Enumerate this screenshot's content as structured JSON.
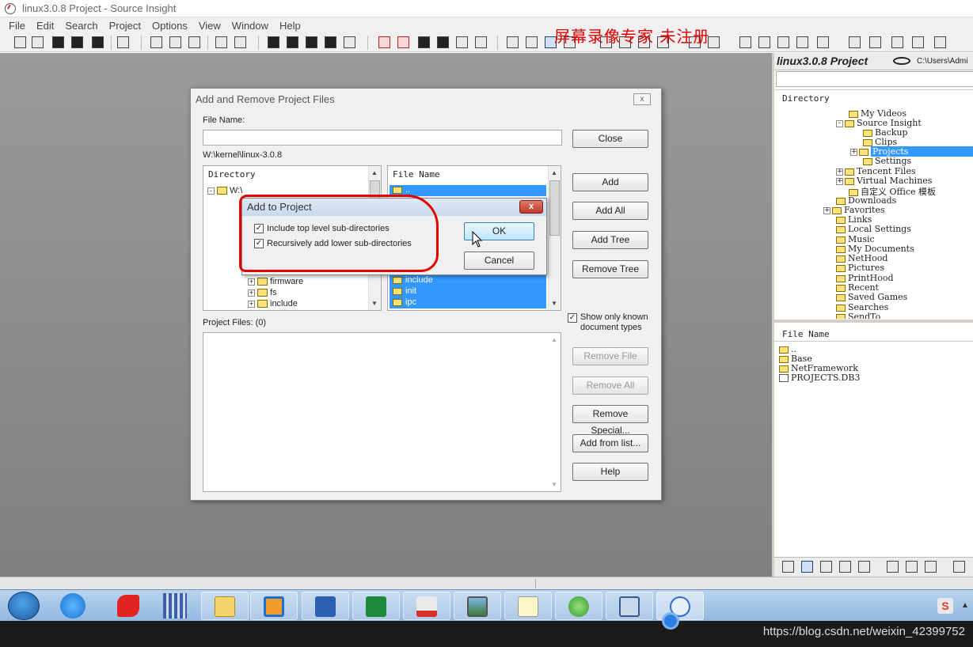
{
  "window": {
    "title": "linux3.0.8 Project - Source Insight"
  },
  "menu": [
    "File",
    "Edit",
    "Search",
    "Project",
    "Options",
    "View",
    "Window",
    "Help"
  ],
  "watermark": "屏幕录像专家 未注册",
  "dialog": {
    "title": "Add and Remove Project Files",
    "close_icon": "x",
    "file_name_label": "File Name:",
    "file_name_value": "",
    "path": "W:\\kernel\\linux-3.0.8",
    "directory_header": "Directory",
    "file_name_header": "File Name",
    "tree": [
      {
        "label": "W:\\",
        "expander": "-"
      },
      {
        "label": "firmware",
        "expander": "+"
      },
      {
        "label": "fs",
        "expander": "+"
      },
      {
        "label": "include",
        "expander": "+"
      }
    ],
    "files": [
      "..",
      "include",
      "init",
      "ipc"
    ],
    "project_files_label": "Project Files: (0)",
    "show_only_known": "Show only known document types",
    "buttons": {
      "close": "Close",
      "add": "Add",
      "add_all": "Add All",
      "add_tree": "Add Tree",
      "remove_tree": "Remove Tree",
      "remove_file": "Remove File",
      "remove_all": "Remove All",
      "remove_special": "Remove Special...",
      "add_from_list": "Add from list...",
      "help": "Help"
    }
  },
  "subdialog": {
    "title": "Add to Project",
    "include_top": "Include top level sub-directories",
    "recursive": "Recursively add lower sub-directories",
    "ok": "OK",
    "cancel": "Cancel",
    "close_icon": "x"
  },
  "right_panel": {
    "title": "linux3.0.8 Project",
    "path": "C:\\Users\\Admi",
    "directory_header": "Directory",
    "tree": [
      "My Videos",
      "Source Insight",
      "Backup",
      "Clips",
      "Projects",
      "Settings",
      "Tencent Files",
      "Virtual Machines",
      "自定义 Office 模板",
      "Downloads",
      "Favorites",
      "Links",
      "Local Settings",
      "Music",
      "My Documents",
      "NetHood",
      "Pictures",
      "PrintHood",
      "Recent",
      "Saved Games",
      "Searches",
      "SendTo"
    ],
    "file_name_header": "File Name",
    "files": [
      "..",
      "Base",
      "NetFramework",
      "PROJECTS.DB3"
    ]
  },
  "footer_url": "https://blog.csdn.net/weixin_42399752",
  "colors": {
    "selection": "#3399ff",
    "annotation_red": "#e00000",
    "taskbar_blue": "#b9d3ee"
  }
}
